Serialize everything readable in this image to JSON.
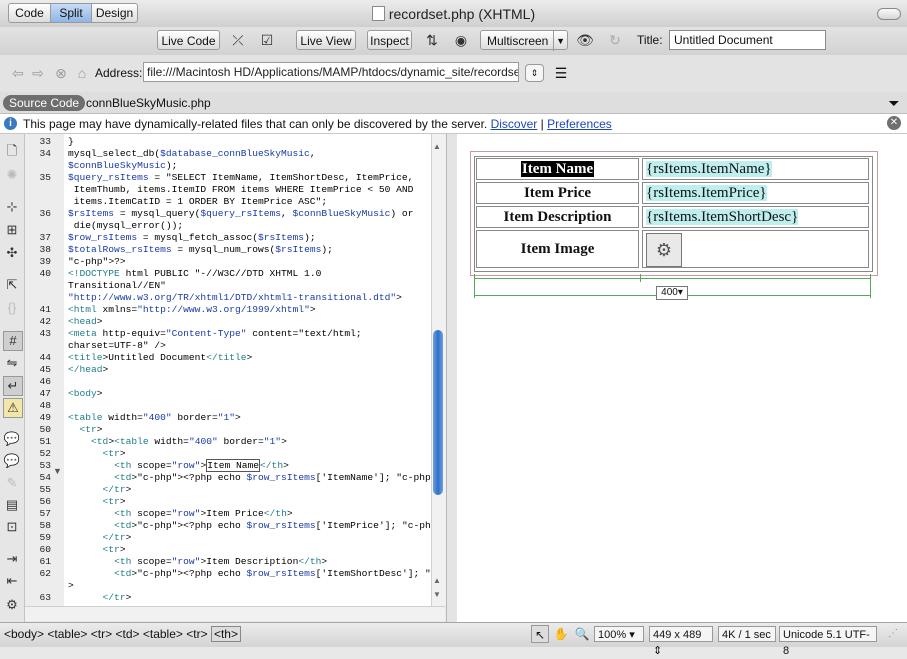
{
  "window": {
    "title": "recordset.php (XHTML)"
  },
  "toolbar": {
    "views": [
      "Code",
      "Split",
      "Design"
    ],
    "active_view": "Split",
    "live_code": "Live Code",
    "live_view": "Live View",
    "inspect": "Inspect",
    "multiscreen": "Multiscreen",
    "title_label": "Title:",
    "title_value": "Untitled Document"
  },
  "address": {
    "label": "Address:",
    "value": "file:///Macintosh HD/Applications/MAMP/htdocs/dynamic_site/recordset.ph"
  },
  "related": {
    "source_code": "Source Code",
    "file": "connBlueSkyMusic.php"
  },
  "info": {
    "text": "This page may have dynamically-related files that can only be discovered by the server.",
    "discover": "Discover",
    "sep": "|",
    "preferences": "Preferences"
  },
  "code": {
    "lines": [
      {
        "n": "33",
        "t": "}"
      },
      {
        "n": "34",
        "t": "mysql_select_db($database_connBlueSkyMusic,"
      },
      {
        "n": "",
        "t": "$connBlueSkyMusic);"
      },
      {
        "n": "35",
        "t": "$query_rsItems = \"SELECT ItemName, ItemShortDesc, ItemPrice,"
      },
      {
        "n": "",
        "t": " ItemThumb, items.ItemID FROM items WHERE ItemPrice < 50 AND"
      },
      {
        "n": "",
        "t": " items.ItemCatID = 1 ORDER BY ItemPrice ASC\";"
      },
      {
        "n": "36",
        "t": "$rsItems = mysql_query($query_rsItems, $connBlueSkyMusic) or"
      },
      {
        "n": "",
        "t": " die(mysql_error());"
      },
      {
        "n": "37",
        "t": "$row_rsItems = mysql_fetch_assoc($rsItems);"
      },
      {
        "n": "38",
        "t": "$totalRows_rsItems = mysql_num_rows($rsItems);"
      },
      {
        "n": "39",
        "t": "?>"
      },
      {
        "n": "40",
        "t": "<!DOCTYPE html PUBLIC \"-//W3C//DTD XHTML 1.0"
      },
      {
        "n": "",
        "t": "Transitional//EN\""
      },
      {
        "n": "",
        "t": "\"http://www.w3.org/TR/xhtml1/DTD/xhtml1-transitional.dtd\">"
      },
      {
        "n": "41",
        "t": "<html xmlns=\"http://www.w3.org/1999/xhtml\">"
      },
      {
        "n": "42",
        "t": "<head>"
      },
      {
        "n": "43",
        "t": "<meta http-equiv=\"Content-Type\" content=\"text/html;"
      },
      {
        "n": "",
        "t": "charset=UTF-8\" />"
      },
      {
        "n": "44",
        "t": "<title>Untitled Document</title>"
      },
      {
        "n": "45",
        "t": "</head>"
      },
      {
        "n": "46",
        "t": ""
      },
      {
        "n": "47",
        "t": "<body>"
      },
      {
        "n": "48",
        "t": ""
      },
      {
        "n": "49",
        "t": "<table width=\"400\" border=\"1\">"
      },
      {
        "n": "50",
        "t": "  <tr>"
      },
      {
        "n": "51",
        "t": "    <td><table width=\"400\" border=\"1\">"
      },
      {
        "n": "52",
        "t": "      <tr>"
      },
      {
        "n": "53",
        "t": "        <th scope=\"row\">Item Name</th>"
      },
      {
        "n": "54",
        "t": "        <td><?php echo $row_rsItems['ItemName']; ?></td>"
      },
      {
        "n": "55",
        "t": "      </tr>"
      },
      {
        "n": "56",
        "t": "      <tr>"
      },
      {
        "n": "57",
        "t": "        <th scope=\"row\">Item Price</th>"
      },
      {
        "n": "58",
        "t": "        <td><?php echo $row_rsItems['ItemPrice']; ?></td>"
      },
      {
        "n": "59",
        "t": "      </tr>"
      },
      {
        "n": "60",
        "t": "      <tr>"
      },
      {
        "n": "61",
        "t": "        <th scope=\"row\">Item Description</th>"
      },
      {
        "n": "62",
        "t": "        <td><?php echo $row_rsItems['ItemShortDesc']; ?></td"
      },
      {
        "n": "",
        "t": ">"
      },
      {
        "n": "63",
        "t": "      </tr>"
      }
    ]
  },
  "design": {
    "rows": [
      {
        "label": "Item Name",
        "value": "{rsItems.ItemName}"
      },
      {
        "label": "Item Price",
        "value": "{rsItems.ItemPrice}"
      },
      {
        "label": "Item Description",
        "value": "{rsItems.ItemShortDesc}"
      },
      {
        "label": "Item Image",
        "value": ""
      }
    ],
    "table_width": "400"
  },
  "status": {
    "tags": [
      "<body>",
      "<table>",
      "<tr>",
      "<td>",
      "<table>",
      "<tr>"
    ],
    "selected_tag": "<th>",
    "zoom": "100%",
    "window_size": "449 x 489",
    "download": "4K / 1 sec",
    "encoding": "Unicode 5.1 UTF-8"
  }
}
